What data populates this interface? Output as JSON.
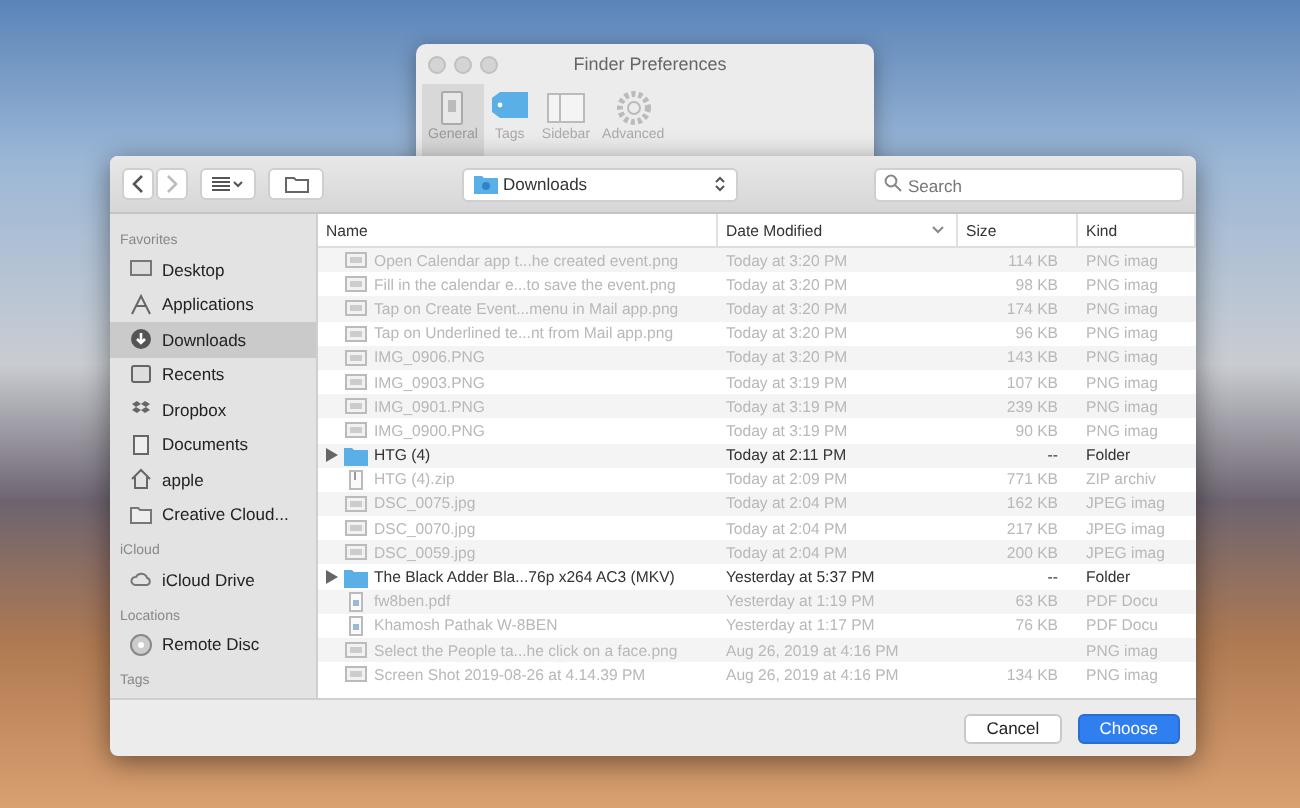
{
  "prefs_window": {
    "title": "Finder Preferences",
    "tabs": [
      {
        "label": "General",
        "selected": true
      },
      {
        "label": "Tags",
        "selected": false
      },
      {
        "label": "Sidebar",
        "selected": false
      },
      {
        "label": "Advanced",
        "selected": false
      }
    ]
  },
  "toolbar": {
    "location": "Downloads",
    "search": {
      "placeholder": "Search"
    }
  },
  "sidebar": [
    {
      "heading": "Favorites",
      "items": [
        {
          "label": "Desktop",
          "selected": false
        },
        {
          "label": "Applications",
          "selected": false
        },
        {
          "label": "Downloads",
          "selected": true
        },
        {
          "label": "Recents",
          "selected": false
        },
        {
          "label": "Dropbox",
          "selected": false
        },
        {
          "label": "Documents",
          "selected": false
        },
        {
          "label": "apple",
          "selected": false
        },
        {
          "label": "Creative Cloud...",
          "selected": false
        }
      ]
    },
    {
      "heading": "iCloud",
      "items": [
        {
          "label": "iCloud Drive",
          "selected": false
        }
      ]
    },
    {
      "heading": "Locations",
      "items": [
        {
          "label": "Remote Disc",
          "selected": false
        }
      ]
    },
    {
      "heading": "Tags"
    }
  ],
  "table": {
    "columns": [
      "Name",
      "Date Modified",
      "Size",
      "Kind"
    ],
    "rows": [
      {
        "kind": "image",
        "name": "Open Calendar app t...he created event.png",
        "date": "Today at 3:20 PM",
        "size": "114 KB",
        "type": "PNG imag",
        "disabled": true
      },
      {
        "kind": "image",
        "name": "Fill in the calendar e...to save the event.png",
        "date": "Today at 3:20 PM",
        "size": "98 KB",
        "type": "PNG imag",
        "disabled": true
      },
      {
        "kind": "image",
        "name": "Tap on Create Event...menu in Mail app.png",
        "date": "Today at 3:20 PM",
        "size": "174 KB",
        "type": "PNG imag",
        "disabled": true
      },
      {
        "kind": "image",
        "name": "Tap on Underlined te...nt from Mail app.png",
        "date": "Today at 3:20 PM",
        "size": "96 KB",
        "type": "PNG imag",
        "disabled": true
      },
      {
        "kind": "image",
        "name": "IMG_0906.PNG",
        "date": "Today at 3:20 PM",
        "size": "143 KB",
        "type": "PNG imag",
        "disabled": true
      },
      {
        "kind": "image",
        "name": "IMG_0903.PNG",
        "date": "Today at 3:19 PM",
        "size": "107 KB",
        "type": "PNG imag",
        "disabled": true
      },
      {
        "kind": "image",
        "name": "IMG_0901.PNG",
        "date": "Today at 3:19 PM",
        "size": "239 KB",
        "type": "PNG imag",
        "disabled": true
      },
      {
        "kind": "image",
        "name": "IMG_0900.PNG",
        "date": "Today at 3:19 PM",
        "size": "90 KB",
        "type": "PNG imag",
        "disabled": true
      },
      {
        "kind": "folder",
        "name": "HTG (4)",
        "date": "Today at 2:11 PM",
        "size": "--",
        "type": "Folder",
        "disabled": false
      },
      {
        "kind": "zip",
        "name": "HTG (4).zip",
        "date": "Today at 2:09 PM",
        "size": "771 KB",
        "type": "ZIP archiv",
        "disabled": true
      },
      {
        "kind": "image",
        "name": "DSC_0075.jpg",
        "date": "Today at 2:04 PM",
        "size": "162 KB",
        "type": "JPEG imag",
        "disabled": true
      },
      {
        "kind": "image",
        "name": "DSC_0070.jpg",
        "date": "Today at 2:04 PM",
        "size": "217 KB",
        "type": "JPEG imag",
        "disabled": true
      },
      {
        "kind": "image",
        "name": "DSC_0059.jpg",
        "date": "Today at 2:04 PM",
        "size": "200 KB",
        "type": "JPEG imag",
        "disabled": true
      },
      {
        "kind": "folder",
        "name": "The Black Adder Bla...76p x264 AC3 (MKV)",
        "date": "Yesterday at 5:37 PM",
        "size": "--",
        "type": "Folder",
        "disabled": false
      },
      {
        "kind": "pdf",
        "name": "fw8ben.pdf",
        "date": "Yesterday at 1:19 PM",
        "size": "63 KB",
        "type": "PDF Docu",
        "disabled": true
      },
      {
        "kind": "pdf",
        "name": "Khamosh Pathak W-8BEN",
        "date": "Yesterday at 1:17 PM",
        "size": "76 KB",
        "type": "PDF Docu",
        "disabled": true
      },
      {
        "kind": "image",
        "name": "Select the People ta...he click on a face.png",
        "date": "Aug 26, 2019 at 4:16 PM",
        "type": "PNG imag",
        "disabled": true
      },
      {
        "kind": "image",
        "name": "Screen Shot 2019-08-26 at 4.14.39 PM",
        "date": "Aug 26, 2019 at 4:16 PM",
        "size": "134 KB",
        "type": "PNG imag",
        "disabled": true
      }
    ]
  },
  "buttons": {
    "cancel": "Cancel",
    "choose": "Choose"
  }
}
